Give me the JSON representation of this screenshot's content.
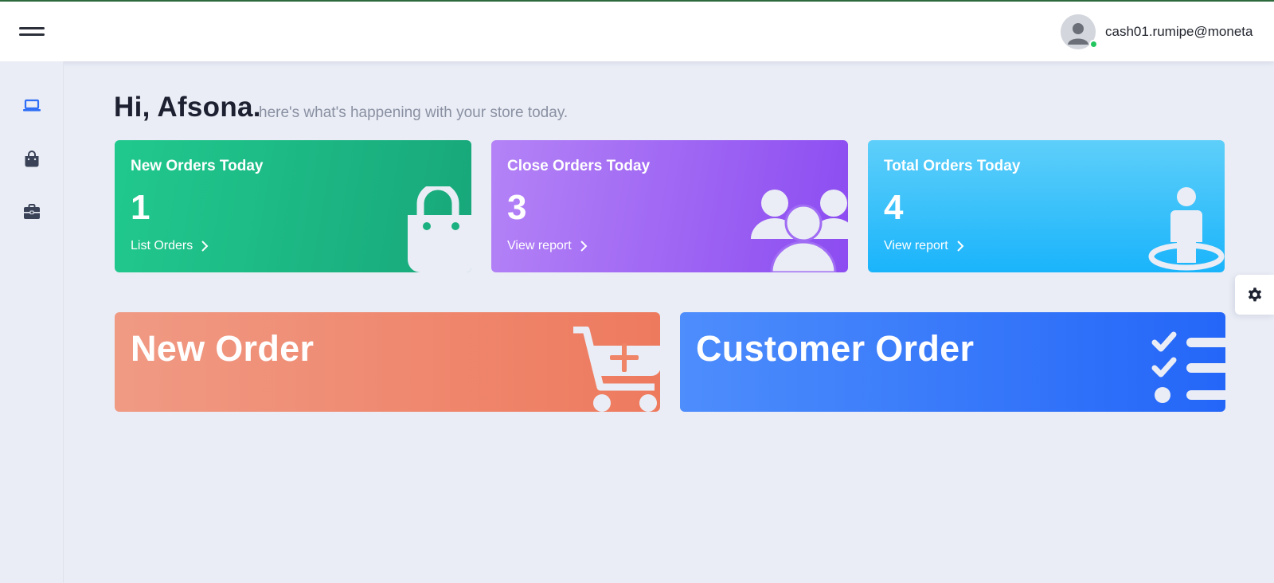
{
  "header": {
    "user_email": "cash01.rumipe@moneta"
  },
  "sidebar": {
    "items": [
      {
        "icon": "laptop-icon",
        "active": true
      },
      {
        "icon": "shopping-bag-icon",
        "active": false
      },
      {
        "icon": "briefcase-icon",
        "active": false
      }
    ]
  },
  "greeting": {
    "title": "Hi, Afsona.",
    "subtitle": "here's what's happening with your store today."
  },
  "stats": [
    {
      "title": "New Orders Today",
      "value": "1",
      "link": "List Orders",
      "icon": "shopping-bag-icon"
    },
    {
      "title": "Close Orders Today",
      "value": "3",
      "link": "View report",
      "icon": "users-group-icon"
    },
    {
      "title": "Total Orders Today",
      "value": "4",
      "link": "View report",
      "icon": "person-location-icon"
    }
  ],
  "actions": [
    {
      "title": "New Order",
      "icon": "cart-plus-icon"
    },
    {
      "title": "Customer Order",
      "icon": "checklist-icon"
    }
  ],
  "colors": {
    "green": "#1fbf88",
    "purple": "#9b5cf3",
    "sky": "#36c1fa",
    "orange": "#ef8a70",
    "royal": "#3576fa",
    "sidebar_active": "#2f6ef6",
    "status_online": "#22c55e"
  }
}
